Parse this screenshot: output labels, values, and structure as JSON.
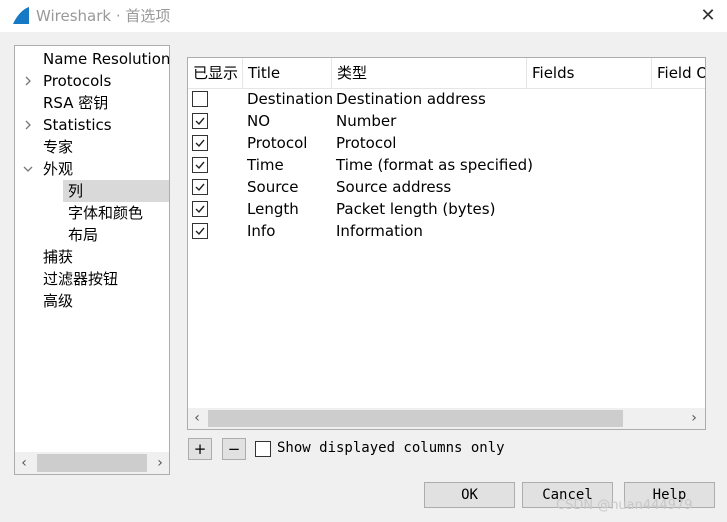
{
  "window": {
    "title": "Wireshark · 首选项",
    "close_icon": "close-icon"
  },
  "tree": {
    "items": [
      {
        "label": "Name Resolution",
        "arrow": "none"
      },
      {
        "label": "Protocols",
        "arrow": "right"
      },
      {
        "label": "RSA 密钥",
        "arrow": "none"
      },
      {
        "label": "Statistics",
        "arrow": "right"
      },
      {
        "label": "专家",
        "arrow": "none"
      },
      {
        "label": "外观",
        "arrow": "down"
      },
      {
        "label": "列",
        "arrow": "none",
        "selected": true
      },
      {
        "label": "字体和颜色",
        "arrow": "none"
      },
      {
        "label": "布局",
        "arrow": "none"
      },
      {
        "label": "捕获",
        "arrow": "none"
      },
      {
        "label": "过滤器按钮",
        "arrow": "none"
      },
      {
        "label": "高级",
        "arrow": "none"
      }
    ]
  },
  "columns_table": {
    "headers": [
      "已显示",
      "Title",
      "类型",
      "Fields",
      "Field O"
    ],
    "rows": [
      {
        "shown": false,
        "title": "Destination",
        "type": "Destination address"
      },
      {
        "shown": true,
        "title": "NO",
        "type": "Number"
      },
      {
        "shown": true,
        "title": "Protocol",
        "type": "Protocol"
      },
      {
        "shown": true,
        "title": "Time",
        "type": "Time (format as specified)"
      },
      {
        "shown": true,
        "title": "Source",
        "type": "Source address"
      },
      {
        "shown": true,
        "title": "Length",
        "type": "Packet length (bytes)"
      },
      {
        "shown": true,
        "title": "Info",
        "type": "Information"
      }
    ]
  },
  "controls": {
    "add_label": "+",
    "remove_label": "−",
    "show_displayed_only_label": "Show displayed columns only",
    "show_displayed_only_checked": false
  },
  "buttons": {
    "ok": "OK",
    "cancel": "Cancel",
    "help": "Help"
  },
  "watermark": "CSDN @nuan444979",
  "colors": {
    "selection": "#d9d9d9",
    "border": "#adadad",
    "background": "#f0f0f0"
  }
}
